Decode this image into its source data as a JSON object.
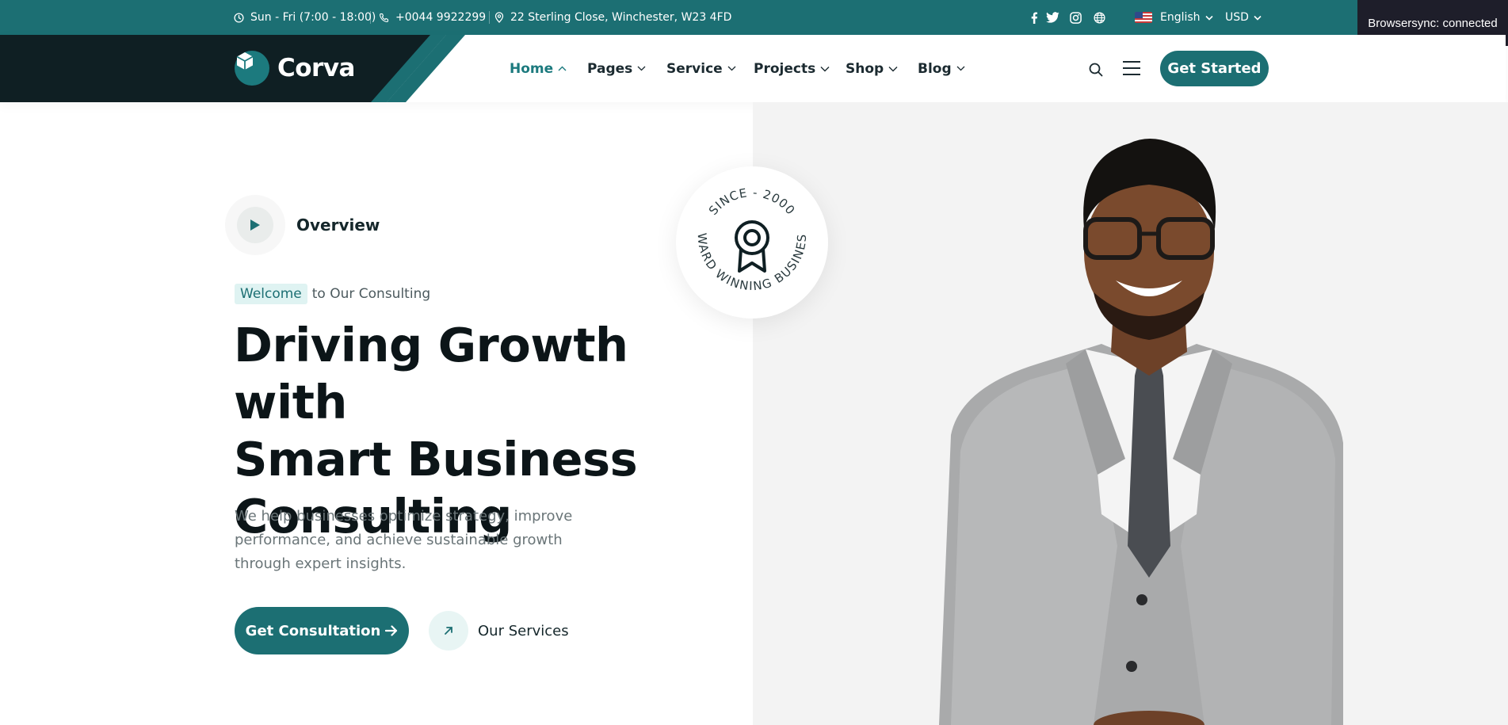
{
  "topbar": {
    "hours": "Sun - Fri (7:00 - 18:00)",
    "phone": "+0044 9922299",
    "address": "22 Sterling Close, Winchester, W23 4FD",
    "social_icons": [
      "facebook-icon",
      "twitter-icon",
      "instagram-icon",
      "globe-icon"
    ],
    "language": "English",
    "currency": "USD"
  },
  "browsersync": {
    "status": "Browsersync: connected"
  },
  "header": {
    "logo_text": "Corva",
    "nav": [
      {
        "label": "Home",
        "active": true
      },
      {
        "label": "Pages",
        "active": false
      },
      {
        "label": "Service",
        "active": false
      },
      {
        "label": "Projects",
        "active": false
      },
      {
        "label": "Shop",
        "active": false
      },
      {
        "label": "Blog",
        "active": false
      }
    ],
    "cta_label": "Get Started"
  },
  "hero": {
    "overview_label": "Overview",
    "welcome_highlight": "Welcome",
    "welcome_rest": "to Our Consulting",
    "title_lines": [
      "Driving Growth with",
      "Smart Business",
      "Consulting"
    ],
    "description": "We help businesses optimize strategy, improve performance, and achieve sustainable growth through expert insights.",
    "primary_button": "Get Consultation",
    "secondary_link": "Our Services",
    "badge_top": "SINCE - 2000",
    "badge_bottom": "AWARD WINNING BUSINESS"
  },
  "colors": {
    "brand_teal": "#1c6f73",
    "dark_navy": "#0f1f23",
    "accent_light": "#dff3f2",
    "hero_right_bg": "#f3f3f3"
  }
}
